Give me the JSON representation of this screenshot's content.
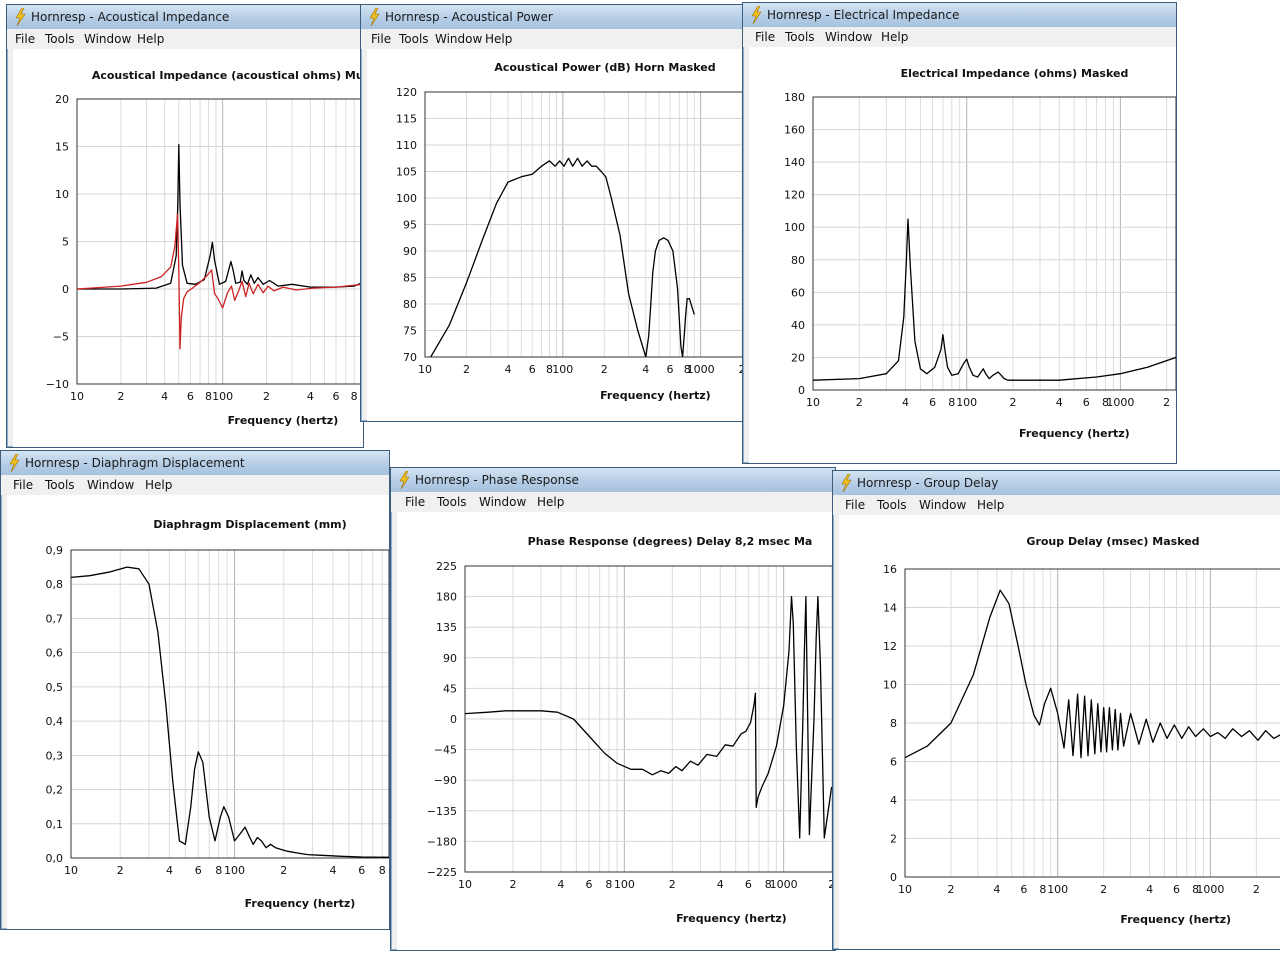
{
  "menu": [
    "File",
    "Tools",
    "Window",
    "Help"
  ],
  "windows": [
    {
      "id": "w1",
      "title": "Hornresp - Acoustical Impedance",
      "chart_data": {
        "type": "line",
        "title": "Acoustical Impedance (acoustical ohms)   Multipl",
        "xlabel": "Frequency (hertz)",
        "ylabel": "",
        "xscale": "log",
        "xlim": [
          10,
          920
        ],
        "ylim": [
          -10,
          20
        ],
        "yticks": [
          "20",
          "15",
          "10",
          "5",
          "0",
          "−5",
          "−10"
        ],
        "xticks": [
          "10",
          "2",
          "4",
          "6",
          "8",
          "100",
          "2",
          "4",
          "6",
          "8"
        ],
        "grid": true,
        "series": [
          {
            "color": "#000000",
            "x": [
              10,
              20,
              35,
              44,
              48,
              49.2,
              50,
              51,
              53,
              57,
              65,
              75,
              82,
              85,
              88,
              95,
              105,
              110,
              114,
              118,
              123,
              132,
              136,
              140,
              148,
              156,
              165,
              175,
              190,
              210,
              240,
              300,
              400,
              600,
              800,
              920
            ],
            "y": [
              0,
              0,
              0.1,
              0.6,
              3.5,
              9,
              15.2,
              9,
              2.5,
              0.6,
              0.5,
              1,
              3.5,
              4.9,
              3,
              0.5,
              0.8,
              2,
              2.9,
              2,
              0.6,
              0.7,
              1.9,
              0.9,
              0.5,
              1.5,
              0.6,
              1.2,
              0.5,
              0.9,
              0.3,
              0.5,
              0.2,
              0.2,
              0.3,
              0.7
            ]
          },
          {
            "color": "#cc2222",
            "x": [
              10,
              20,
              30,
              38,
              44,
              47,
              49,
              50,
              51,
              52,
              54,
              57,
              62,
              70,
              78,
              84,
              88,
              93,
              100,
              108,
              115,
              121,
              128,
              136,
              144,
              152,
              162,
              175,
              190,
              205,
              225,
              260,
              320,
              420,
              600,
              920
            ],
            "y": [
              0,
              0.3,
              0.7,
              1.3,
              2.3,
              4.5,
              7.9,
              2,
              -6.3,
              -3,
              -1,
              -0.3,
              0.1,
              0.7,
              1.4,
              2,
              -0.5,
              -1,
              -2,
              -0.4,
              0.3,
              -1.2,
              -0.3,
              0.8,
              -0.8,
              0.6,
              -0.5,
              0.5,
              -0.4,
              0.3,
              -0.2,
              0.2,
              -0.1,
              0.1,
              0.2,
              0.5
            ]
          }
        ]
      }
    },
    {
      "id": "w2",
      "title": "Hornresp - Acoustical Power",
      "chart_data": {
        "type": "line",
        "title": "Acoustical Power (dB)   Horn   Masked",
        "xlabel": "Frequency (hertz)",
        "ylabel": "",
        "xscale": "log",
        "xlim": [
          10,
          2100
        ],
        "ylim": [
          70,
          120
        ],
        "yticks": [
          "120",
          "115",
          "110",
          "105",
          "100",
          "95",
          "90",
          "85",
          "80",
          "75",
          "70"
        ],
        "xticks": [
          "10",
          "2",
          "4",
          "6",
          "8",
          "100",
          "2",
          "4",
          "6",
          "8",
          "1000",
          "2"
        ],
        "grid": true,
        "series": [
          {
            "color": "#000000",
            "x": [
              11,
              15,
              20,
              26,
              33,
              40,
              50,
              60,
              70,
              80,
              88,
              95,
              102,
              110,
              118,
              128,
              138,
              150,
              162,
              175,
              190,
              205,
              225,
              260,
              300,
              350,
              400,
              420,
              435,
              450,
              470,
              500,
              540,
              580,
              630,
              680,
              720,
              740,
              760,
              780,
              800,
              830,
              900
            ],
            "y": [
              70,
              76,
              84,
              92,
              99,
              103,
              104,
              104.5,
              106,
              107,
              106,
              107,
              106,
              107.5,
              106,
              107.5,
              106,
              107,
              106,
              106,
              105,
              104,
              100,
              93,
              82,
              75,
              70,
              74,
              80,
              86,
              90,
              92,
              92.5,
              92,
              90,
              83,
              72,
              70,
              74,
              78,
              81,
              81,
              78
            ]
          }
        ]
      }
    },
    {
      "id": "w3",
      "title": "Hornresp - Electrical Impedance",
      "chart_data": {
        "type": "line",
        "title": "Electrical Impedance (ohms)   Masked",
        "xlabel": "Frequency (hertz)",
        "ylabel": "",
        "xscale": "log",
        "xlim": [
          10,
          2300
        ],
        "ylim": [
          0,
          180
        ],
        "yticks": [
          "180",
          "160",
          "140",
          "120",
          "100",
          "80",
          "60",
          "40",
          "20",
          "0"
        ],
        "xticks": [
          "10",
          "2",
          "4",
          "6",
          "8",
          "100",
          "2",
          "4",
          "6",
          "8",
          "1000",
          "2"
        ],
        "grid": true,
        "series": [
          {
            "color": "#000000",
            "x": [
              10,
              20,
              30,
              36,
              39,
              40.5,
              41.5,
              43,
              46,
              50,
              55,
              62,
              68,
              70,
              72,
              75,
              80,
              88,
              95,
              100,
              104,
              110,
              118,
              128,
              133,
              140,
              148,
              160,
              168,
              175,
              185,
              200,
              250,
              400,
              700,
              1000,
              1500,
              2300
            ],
            "y": [
              6,
              7,
              10,
              18,
              45,
              80,
              105,
              75,
              30,
              13,
              10,
              14,
              25,
              34,
              25,
              14,
              9,
              10,
              16,
              19,
              14,
              9,
              8,
              13,
              10,
              7,
              9,
              11,
              9,
              7,
              6,
              6,
              6,
              6,
              8,
              10,
              14,
              20
            ]
          }
        ]
      }
    },
    {
      "id": "w4",
      "title": "Hornresp - Diaphragm Displacement",
      "chart_data": {
        "type": "line",
        "title": "Diaphragm Displacement (mm)",
        "xlabel": "Frequency (hertz)",
        "ylabel": "",
        "xscale": "log",
        "xlim": [
          10,
          880
        ],
        "ylim": [
          0,
          0.9
        ],
        "yticks": [
          "0,9",
          "0,8",
          "0,7",
          "0,6",
          "0,5",
          "0,4",
          "0,3",
          "0,2",
          "0,1",
          "0,0"
        ],
        "xticks": [
          "10",
          "2",
          "4",
          "6",
          "8",
          "100",
          "2",
          "4",
          "6",
          "8"
        ],
        "grid": true,
        "series": [
          {
            "color": "#000000",
            "x": [
              10,
              13,
              17,
              22,
              26,
              30,
              34,
              38,
              42,
              46,
              50,
              54,
              57,
              60,
              64,
              70,
              76,
              82,
              86,
              92,
              100,
              108,
              116,
              124,
              130,
              138,
              146,
              156,
              166,
              178,
              192,
              210,
              240,
              280,
              340,
              450,
              600,
              880
            ],
            "y": [
              0.82,
              0.825,
              0.835,
              0.85,
              0.845,
              0.8,
              0.66,
              0.45,
              0.22,
              0.05,
              0.04,
              0.15,
              0.26,
              0.31,
              0.28,
              0.12,
              0.05,
              0.12,
              0.15,
              0.12,
              0.05,
              0.07,
              0.09,
              0.06,
              0.04,
              0.06,
              0.05,
              0.03,
              0.04,
              0.03,
              0.025,
              0.02,
              0.015,
              0.01,
              0.008,
              0.005,
              0.003,
              0.002
            ]
          }
        ]
      }
    },
    {
      "id": "w5",
      "title": "Hornresp - Phase Response",
      "chart_data": {
        "type": "line",
        "title": "Phase Response (degrees)   Delay 8,2 msec   Ma",
        "xlabel": "Frequency (hertz)",
        "ylabel": "",
        "xscale": "log",
        "xlim": [
          10,
          2100
        ],
        "ylim": [
          -225,
          225
        ],
        "yticks": [
          "225",
          "180",
          "135",
          "90",
          "45",
          "0",
          "−45",
          "−90",
          "−135",
          "−180",
          "−225"
        ],
        "xticks": [
          "10",
          "2",
          "4",
          "6",
          "8",
          "100",
          "2",
          "4",
          "6",
          "8",
          "1000",
          "2"
        ],
        "grid": true,
        "series": [
          {
            "color": "#000000",
            "x": [
              10,
              14,
              18,
              24,
              30,
              38,
              48,
              60,
              75,
              90,
              110,
              130,
              150,
              170,
              190,
              210,
              230,
              260,
              290,
              330,
              380,
              430,
              480,
              540,
              580,
              620,
              650,
              665,
              672,
              690,
              730,
              800,
              900,
              1000,
              1080,
              1120,
              1150,
              1200,
              1260,
              1320,
              1350,
              1380,
              1450,
              1550,
              1600,
              1640,
              1700,
              1800,
              2000
            ],
            "y": [
              8,
              10,
              12,
              12,
              12,
              10,
              0,
              -25,
              -50,
              -65,
              -74,
              -74,
              -82,
              -76,
              -80,
              -70,
              -76,
              -62,
              -68,
              -52,
              -55,
              -38,
              -40,
              -22,
              -18,
              -5,
              20,
              38,
              -130,
              -115,
              -100,
              -80,
              -40,
              20,
              100,
              180,
              140,
              -40,
              -175,
              0,
              100,
              180,
              -170,
              0,
              120,
              180,
              80,
              -175,
              -100
            ]
          }
        ]
      }
    },
    {
      "id": "w6",
      "title": "Hornresp - Group Delay",
      "chart_data": {
        "type": "line",
        "title": "Group Delay (msec)   Masked",
        "xlabel": "Frequency (hertz)",
        "ylabel": "",
        "xscale": "log",
        "xlim": [
          10,
          2900
        ],
        "ylim": [
          0,
          16
        ],
        "yticks": [
          "16",
          "14",
          "12",
          "10",
          "8",
          "6",
          "4",
          "2",
          "0"
        ],
        "xticks": [
          "10",
          "2",
          "4",
          "6",
          "8",
          "100",
          "2",
          "4",
          "6",
          "8",
          "1000",
          "2"
        ],
        "grid": true,
        "series": [
          {
            "color": "#000000",
            "x": [
              10,
              14,
              20,
              28,
              36,
              42,
              48,
              55,
              62,
              70,
              76,
              82,
              90,
              100,
              110,
              118,
              126,
              135,
              142,
              150,
              158,
              166,
              175,
              183,
              192,
              200,
              209,
              218,
              228,
              238,
              248,
              258,
              270,
              300,
              340,
              380,
              420,
              470,
              520,
              580,
              650,
              720,
              800,
              900,
              1000,
              1120,
              1250,
              1400,
              1600,
              1800,
              2050,
              2300,
              2600,
              2900
            ],
            "y": [
              6.2,
              6.8,
              8,
              10.5,
              13.5,
              14.9,
              14.2,
              12,
              10,
              8.4,
              7.9,
              9,
              9.8,
              8.5,
              6.7,
              9.2,
              6.3,
              9.5,
              6.2,
              9.4,
              6.3,
              9.2,
              6.4,
              9,
              6.5,
              8.8,
              6.5,
              8.8,
              6.6,
              8.7,
              6.6,
              8.5,
              6.8,
              8.5,
              6.9,
              8.2,
              7,
              8,
              7.2,
              7.9,
              7.2,
              7.8,
              7.3,
              7.7,
              7.3,
              7.5,
              7.2,
              7.7,
              7.3,
              7.6,
              7.1,
              7.6,
              7.2,
              7.4
            ]
          }
        ]
      }
    }
  ]
}
